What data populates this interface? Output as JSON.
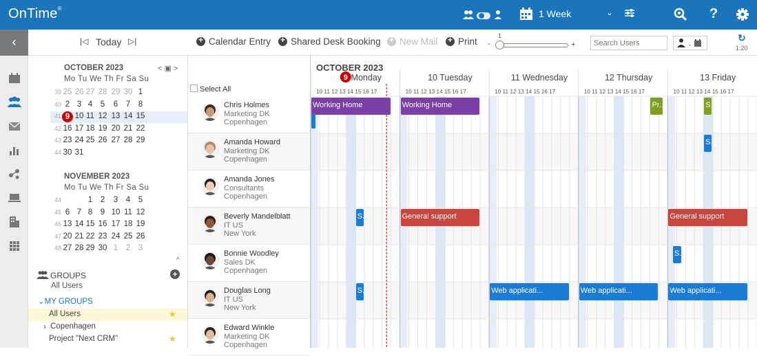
{
  "app": {
    "logo": "OnTime",
    "logo_mark": "®"
  },
  "topbar": {
    "view_label": "1 Week"
  },
  "subbar": {
    "today": "Today",
    "calendar_entry": "Calendar Entry",
    "shared_desk": "Shared Desk Booking",
    "new_mail": "New Mail",
    "print": "Print",
    "zoom_value": "1",
    "zoom_plus": "+",
    "zoom_minus": "-",
    "zoom_level": 0.0,
    "search_placeholder": "Search Users",
    "refresh_time": "1:20"
  },
  "calendar": {
    "month1": {
      "title": "OCTOBER 2023",
      "dow": "Mo Tu We Th Fr Sa Su",
      "weeks": [
        {
          "no": "39",
          "days": [
            "25",
            "26",
            "27",
            "28",
            "29",
            "30",
            "1"
          ],
          "other": [
            true,
            true,
            true,
            true,
            true,
            true,
            false
          ]
        },
        {
          "no": "40",
          "days": [
            "2",
            "3",
            "4",
            "5",
            "6",
            "7",
            "8"
          ],
          "other": [
            false,
            false,
            false,
            false,
            false,
            false,
            false
          ]
        },
        {
          "no": "41",
          "days": [
            "9",
            "10",
            "11",
            "12",
            "13",
            "14",
            "15"
          ],
          "other": [
            false,
            false,
            false,
            false,
            false,
            false,
            false
          ]
        },
        {
          "no": "42",
          "days": [
            "16",
            "17",
            "18",
            "19",
            "20",
            "21",
            "22"
          ],
          "other": [
            false,
            false,
            false,
            false,
            false,
            false,
            false
          ]
        },
        {
          "no": "43",
          "days": [
            "23",
            "24",
            "25",
            "26",
            "27",
            "28",
            "29"
          ],
          "other": [
            false,
            false,
            false,
            false,
            false,
            false,
            false
          ]
        },
        {
          "no": "44",
          "days": [
            "30",
            "31",
            "",
            "",
            "",
            "",
            ""
          ],
          "other": [
            false,
            false,
            false,
            false,
            false,
            false,
            false
          ]
        }
      ]
    },
    "month2": {
      "title": "NOVEMBER 2023",
      "dow": "Mo Tu We Th Fr Sa Su",
      "weeks": [
        {
          "no": "44",
          "days": [
            "",
            "",
            "1",
            "2",
            "3",
            "4",
            "5"
          ],
          "other": [
            false,
            false,
            false,
            false,
            false,
            false,
            false
          ]
        },
        {
          "no": "45",
          "days": [
            "6",
            "7",
            "8",
            "9",
            "10",
            "11",
            "12"
          ],
          "other": [
            false,
            false,
            false,
            false,
            false,
            false,
            false
          ]
        },
        {
          "no": "46",
          "days": [
            "13",
            "14",
            "15",
            "16",
            "17",
            "18",
            "19"
          ],
          "other": [
            false,
            false,
            false,
            false,
            false,
            false,
            false
          ]
        },
        {
          "no": "47",
          "days": [
            "20",
            "21",
            "22",
            "23",
            "24",
            "25",
            "26"
          ],
          "other": [
            false,
            false,
            false,
            false,
            false,
            false,
            false
          ]
        },
        {
          "no": "48",
          "days": [
            "27",
            "28",
            "29",
            "30",
            "1",
            "2",
            "3"
          ],
          "other": [
            false,
            false,
            false,
            false,
            true,
            true,
            true
          ]
        }
      ]
    }
  },
  "groups": {
    "title": "GROUPS",
    "all_users": "All Users",
    "my_groups": "MY GROUPS",
    "items": [
      {
        "label": "All Users",
        "star": true,
        "selected": true
      },
      {
        "label": "Copenhagen",
        "star": false,
        "selected": false
      },
      {
        "label": "Project \"Next CRM\"",
        "star": true,
        "selected": false
      }
    ]
  },
  "users": {
    "select_all": "Select All",
    "rows": [
      {
        "name": "Chris Holmes",
        "dept": "Marketing DK",
        "city": "Copenhagen",
        "skin": "#c99a78",
        "hair": "#3a2a20"
      },
      {
        "name": "Amanda Howard",
        "dept": "Marketing DK",
        "city": "Copenhagen",
        "skin": "#e8c2a6",
        "hair": "#b0886a"
      },
      {
        "name": "Amanda Jones",
        "dept": "Consultants",
        "city": "Copenhagen",
        "skin": "#f0d0bc",
        "hair": "#2a1e18"
      },
      {
        "name": "Beverly Mandelblatt",
        "dept": "IT US",
        "city": "New York",
        "skin": "#8a5a3c",
        "hair": "#3a1a10"
      },
      {
        "name": "Bonnie Woodley",
        "dept": "Sales DK",
        "city": "Copenhagen",
        "skin": "#6e4a36",
        "hair": "#1e1410"
      },
      {
        "name": "Douglas Long",
        "dept": "IT US",
        "city": "New York",
        "skin": "#d8b294",
        "hair": "#2a2018"
      },
      {
        "name": "Edward Winkle",
        "dept": "Marketing DK",
        "city": "Copenhagen",
        "skin": "#e0bca0",
        "hair": "#2a2018"
      }
    ]
  },
  "schedule": {
    "month_title": "OCTOBER 2023",
    "today_badge": "9",
    "days": [
      {
        "label": "Monday"
      },
      {
        "label": "10 Tuesday"
      },
      {
        "label": "11 Wednesday"
      },
      {
        "label": "12 Thursday"
      },
      {
        "label": "13 Friday"
      }
    ],
    "hours": "10 11 12 13 14 15 16 17",
    "now_marker": {
      "day": 0,
      "hour": 16.5
    },
    "events": [
      {
        "row": 0,
        "day": 0,
        "start": 8,
        "end": 17,
        "label": "Working Home",
        "color": "purple"
      },
      {
        "row": 0,
        "day": 1,
        "start": 8,
        "end": 17,
        "label": "Working Home",
        "color": "purple"
      },
      {
        "row": 0,
        "day": 3,
        "start": 16,
        "end": 17.5,
        "label": "Pr...",
        "color": "green"
      },
      {
        "row": 0,
        "day": 4,
        "start": 12,
        "end": 13,
        "label": "S.",
        "color": "green"
      },
      {
        "row": 0,
        "day": 0,
        "start": 8,
        "end": 8.2,
        "label": "",
        "color": "blue",
        "slot": 1
      },
      {
        "row": 1,
        "day": 4,
        "start": 12,
        "end": 13,
        "label": "S.",
        "color": "blue"
      },
      {
        "row": 3,
        "day": 0,
        "start": 13,
        "end": 14,
        "label": "S.",
        "color": "blue"
      },
      {
        "row": 3,
        "day": 1,
        "start": 8,
        "end": 17,
        "label": "General support",
        "color": "red"
      },
      {
        "row": 3,
        "day": 4,
        "start": 8,
        "end": 17,
        "label": "General support",
        "color": "red"
      },
      {
        "row": 4,
        "day": 4,
        "start": 8.5,
        "end": 9.6,
        "label": "S.",
        "color": "blue"
      },
      {
        "row": 5,
        "day": 0,
        "start": 13,
        "end": 14,
        "label": "S.",
        "color": "blue"
      },
      {
        "row": 5,
        "day": 2,
        "start": 8,
        "end": 17,
        "label": "Web applicati...",
        "color": "blue"
      },
      {
        "row": 5,
        "day": 3,
        "start": 8,
        "end": 17,
        "label": "Web applicati...",
        "color": "blue"
      },
      {
        "row": 5,
        "day": 4,
        "start": 8,
        "end": 17,
        "label": "Web applicati...",
        "color": "blue"
      }
    ]
  },
  "colors": {
    "brand": "#1B75BC",
    "today": "#CC0000",
    "purple": "#7B3FA6",
    "red": "#C9453F",
    "blue": "#1B7CD6",
    "green": "#7E9F22",
    "lunch": "#dbe7f7",
    "star": "#f5c518"
  }
}
